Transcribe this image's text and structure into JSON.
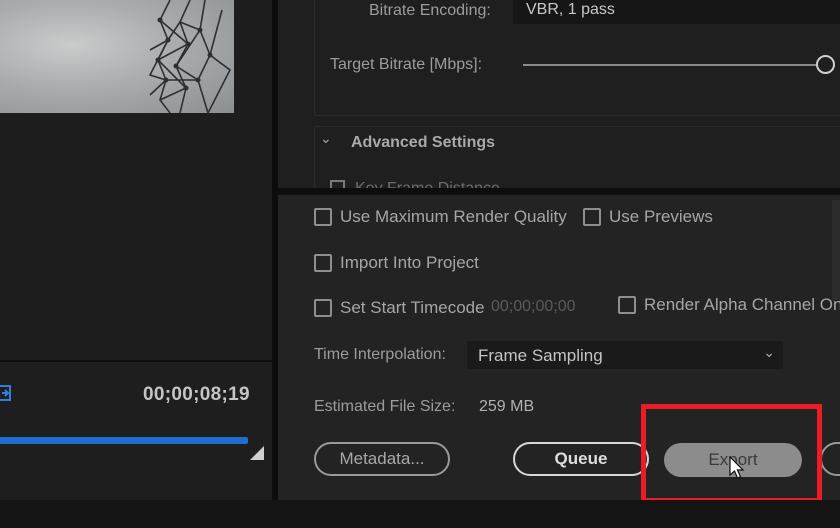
{
  "encoding": {
    "bitrate_encoding_label": "Bitrate Encoding:",
    "bitrate_encoding_value": "VBR, 1 pass",
    "target_bitrate_label": "Target Bitrate [Mbps]:",
    "target_bitrate_slider_fraction": 1.0,
    "advanced_settings_title": "Advanced Settings",
    "advanced_first_option_partial": "Key Frame Distance"
  },
  "preview": {
    "timecode": "00;00;08;19",
    "scrub_progress_fraction": 1.0
  },
  "export_options": {
    "use_max_render_quality": {
      "label": "Use Maximum Render Quality",
      "checked": false
    },
    "use_previews": {
      "label": "Use Previews",
      "checked": false
    },
    "import_into_project": {
      "label": "Import Into Project",
      "checked": false
    },
    "set_start_timecode": {
      "label": "Set Start Timecode",
      "checked": false,
      "value": "00;00;00;00"
    },
    "render_alpha_channel": {
      "label": "Render Alpha Channel Onl",
      "checked": false
    },
    "time_interpolation_label": "Time Interpolation:",
    "time_interpolation_value": "Frame Sampling",
    "estimated_file_size_label": "Estimated File Size:",
    "estimated_file_size_value": "259 MB"
  },
  "buttons": {
    "metadata": "Metadata...",
    "queue": "Queue",
    "export": "Export"
  },
  "colors": {
    "accent_blue": "#1f6ecf",
    "highlight_red": "#ec1c24",
    "panel_bg": "#232323"
  },
  "icons": {
    "chevron": "chevron-down-icon",
    "cursor": "mouse-pointer-icon",
    "source": "source-monitor-icon"
  }
}
